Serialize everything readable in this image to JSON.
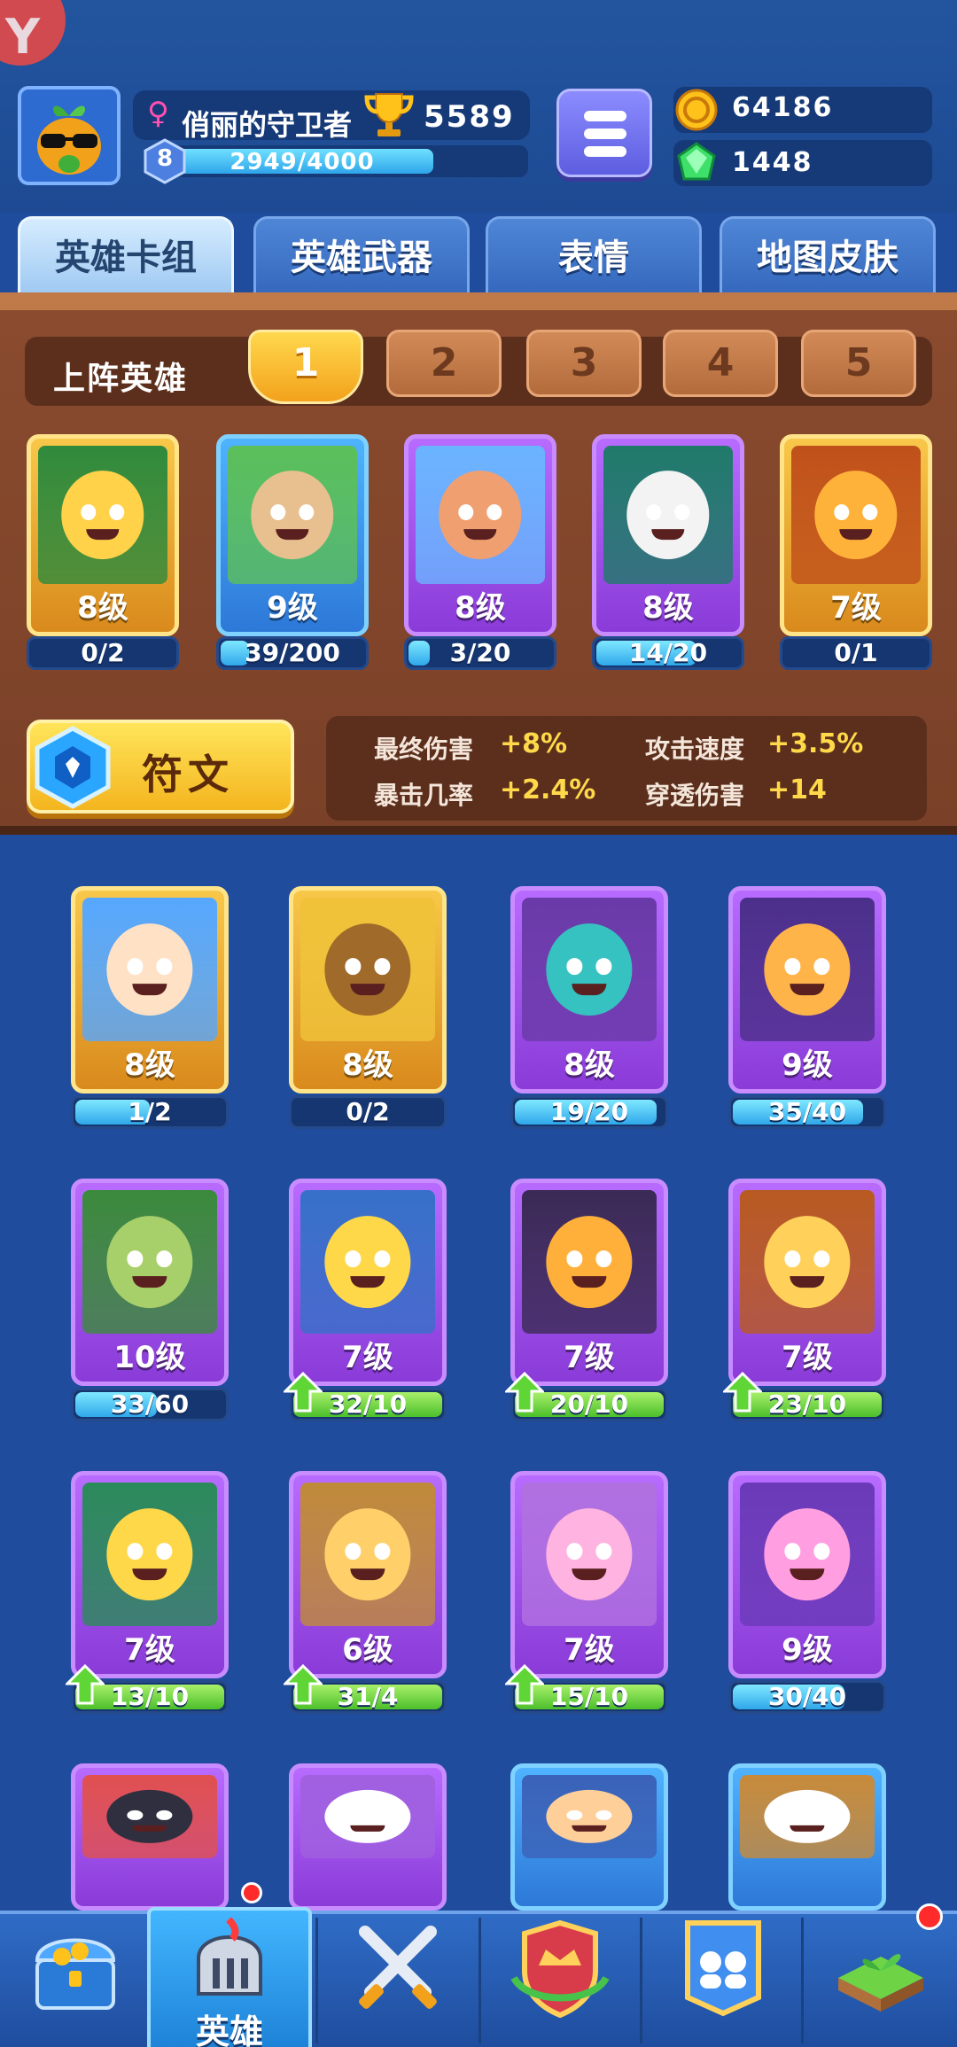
{
  "player": {
    "gender_symbol": "♀",
    "name": "俏丽的守卫者",
    "trophies": "5589",
    "level": "8",
    "xp_text": "2949/4000",
    "xp_progress": 0.737
  },
  "currency": {
    "gold": "64186",
    "gems": "1448"
  },
  "tabs": [
    {
      "label": "英雄卡组"
    },
    {
      "label": "英雄武器"
    },
    {
      "label": "表情"
    },
    {
      "label": "地图皮肤"
    }
  ],
  "lineup": {
    "label": "上阵英雄",
    "slots": [
      "1",
      "2",
      "3",
      "4",
      "5"
    ],
    "active_slot": "1",
    "heroes": [
      {
        "level": "8级",
        "progress": "0/2",
        "fill": 0.0,
        "rarity": "gold"
      },
      {
        "level": "9级",
        "progress": "39/200",
        "fill": 0.195,
        "rarity": "blue"
      },
      {
        "level": "8级",
        "progress": "3/20",
        "fill": 0.15,
        "rarity": "purple"
      },
      {
        "level": "8级",
        "progress": "14/20",
        "fill": 0.7,
        "rarity": "purple"
      },
      {
        "level": "7级",
        "progress": "0/1",
        "fill": 0.0,
        "rarity": "gold"
      }
    ]
  },
  "rune": {
    "label": "符文"
  },
  "stats": [
    {
      "label": "最终伤害",
      "value": "+8%"
    },
    {
      "label": "攻击速度",
      "value": "+3.5%"
    },
    {
      "label": "暴击几率",
      "value": "+2.4%"
    },
    {
      "label": "穿透伤害",
      "value": "+14"
    }
  ],
  "collection": [
    {
      "level": "8级",
      "progress": "1/2",
      "fill": 0.5,
      "rarity": "gold",
      "upgradable": false
    },
    {
      "level": "8级",
      "progress": "0/2",
      "fill": 0.0,
      "rarity": "gold",
      "upgradable": false
    },
    {
      "level": "8级",
      "progress": "19/20",
      "fill": 0.95,
      "rarity": "purple",
      "upgradable": false
    },
    {
      "level": "9级",
      "progress": "35/40",
      "fill": 0.875,
      "rarity": "purple",
      "upgradable": false
    },
    {
      "level": "10级",
      "progress": "33/60",
      "fill": 0.55,
      "rarity": "purple",
      "upgradable": false
    },
    {
      "level": "7级",
      "progress": "32/10",
      "fill": 1.0,
      "rarity": "purple",
      "upgradable": true
    },
    {
      "level": "7级",
      "progress": "20/10",
      "fill": 1.0,
      "rarity": "purple",
      "upgradable": true
    },
    {
      "level": "7级",
      "progress": "23/10",
      "fill": 1.0,
      "rarity": "purple",
      "upgradable": true
    },
    {
      "level": "7级",
      "progress": "13/10",
      "fill": 1.0,
      "rarity": "purple",
      "upgradable": true
    },
    {
      "level": "6级",
      "progress": "31/4",
      "fill": 1.0,
      "rarity": "purple",
      "upgradable": true
    },
    {
      "level": "7级",
      "progress": "15/10",
      "fill": 1.0,
      "rarity": "purple",
      "upgradable": true
    },
    {
      "level": "9级",
      "progress": "30/40",
      "fill": 0.75,
      "rarity": "purple",
      "upgradable": false
    },
    {
      "level": "",
      "progress": "",
      "fill": 0,
      "rarity": "purple",
      "upgradable": false
    },
    {
      "level": "",
      "progress": "",
      "fill": 0,
      "rarity": "purple",
      "upgradable": false
    },
    {
      "level": "",
      "progress": "",
      "fill": 0,
      "rarity": "blue",
      "upgradable": false
    },
    {
      "level": "",
      "progress": "",
      "fill": 0,
      "rarity": "blue",
      "upgradable": false
    }
  ],
  "nav": {
    "items": [
      "treasure-chest-icon",
      "hero-helmet-icon",
      "crossed-swords-icon",
      "crown-shield-icon",
      "team-banner-icon",
      "sprout-island-icon"
    ],
    "active_label": "英雄"
  },
  "colors": {
    "background": "#1f4c9d",
    "wood": "#7a4128",
    "gold_frame": "#f8c84a",
    "purple_frame": "#b86bff",
    "blue_frame": "#4fb3ff",
    "progress_blue": "#2fa7ea",
    "progress_green": "#4cbf2b",
    "stat_value": "#ffd94a"
  }
}
